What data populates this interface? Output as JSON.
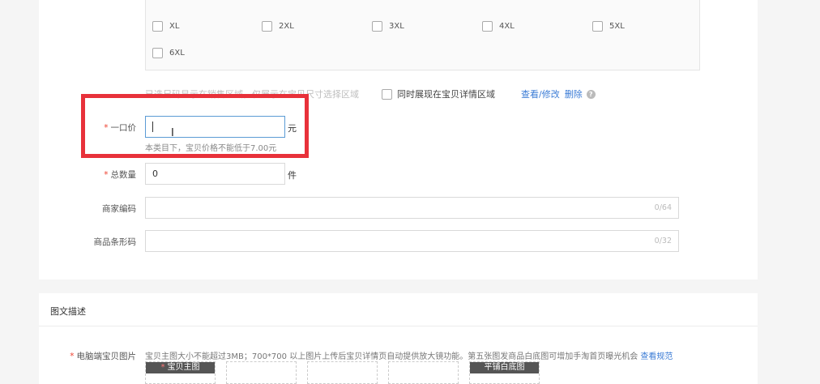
{
  "sizes": [
    "XL",
    "2XL",
    "3XL",
    "4XL",
    "5XL",
    "6XL"
  ],
  "display_note": {
    "faded_text": "已选尺码显示在销售区域，仅展示在宝贝尺寸选择区域",
    "checkbox_label": "同时展现在宝贝详情区域",
    "edit_link": "查看/修改",
    "delete_link": "删除",
    "help_icon": "?"
  },
  "price": {
    "required_mark": "*",
    "label": "一口价",
    "value": "",
    "unit": "元",
    "hint": "本类目下，宝贝价格不能低于7.00元"
  },
  "quantity": {
    "required_mark": "*",
    "label": "总数量",
    "value": "0",
    "unit": "件"
  },
  "merchant_code": {
    "label": "商家编码",
    "counter": "0/64"
  },
  "barcode": {
    "label": "商品条形码",
    "counter": "0/32"
  },
  "description_section": {
    "title": "图文描述",
    "pc_images": {
      "required_mark": "*",
      "label": "电脑端宝贝图片",
      "hint": "宝贝主图大小不能超过3MB；700*700 以上图片上传后宝贝详情页自动提供放大镜功能。第五张图发商品白底图可增加手淘首页曝光机会",
      "hint_link": "查看规范",
      "main_slot_label": "宝贝主图",
      "white_slot_label": "平铺白底图"
    }
  },
  "colors": {
    "highlight": "#e8313a",
    "link": "#3a7bd5",
    "required": "#e43"
  }
}
